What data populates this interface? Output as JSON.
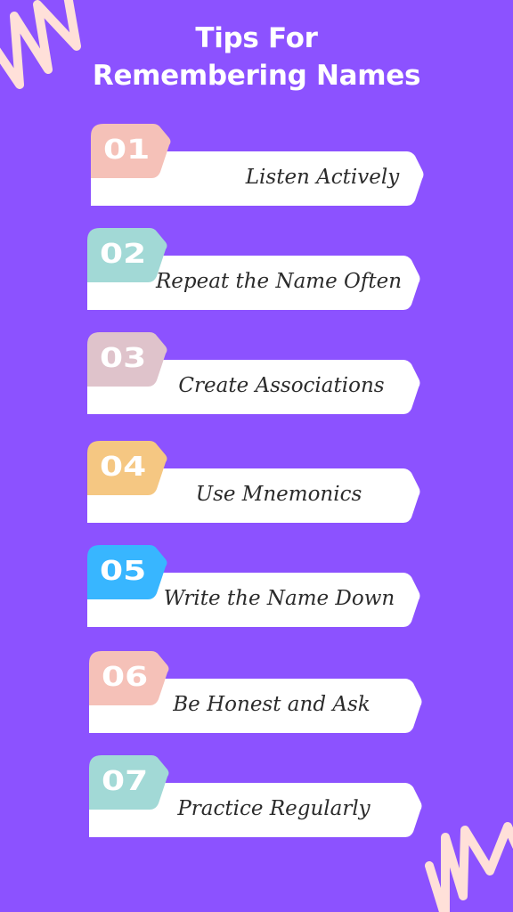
{
  "title": {
    "line1": "Tips For",
    "line2": "Remembering Names"
  },
  "colors": {
    "background": "#8c52ff",
    "card": "#ffffff",
    "text": "#2b2b2b",
    "squiggle": "#ffe0d9"
  },
  "tips": [
    {
      "number": "01",
      "label": "Listen Actively",
      "color": "#f5c1b8"
    },
    {
      "number": "02",
      "label": "Repeat the Name Often",
      "color": "#a2d9d6"
    },
    {
      "number": "03",
      "label": "Create Associations",
      "color": "#dfc3cb"
    },
    {
      "number": "04",
      "label": "Use Mnemonics",
      "color": "#f5c782"
    },
    {
      "number": "05",
      "label": "Write the Name Down",
      "color": "#38b6ff"
    },
    {
      "number": "06",
      "label": "Be Honest and Ask",
      "color": "#f5c1b8"
    },
    {
      "number": "07",
      "label": "Practice Regularly",
      "color": "#a2d9d6"
    }
  ]
}
